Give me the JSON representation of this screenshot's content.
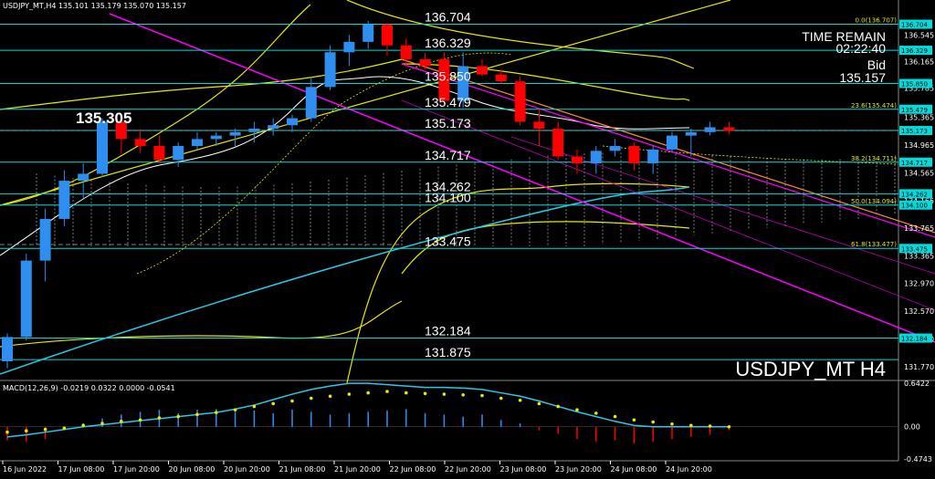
{
  "header": {
    "text": "USDJPY_MT,H4  135.101 135.179 135.070 135.157"
  },
  "symbol_label": "USDJPY_MT H4",
  "time_remain": {
    "label": "TIME REMAIN",
    "value": "02:22:40"
  },
  "bid": {
    "label": "Bid",
    "value": "135.157"
  },
  "macd_label": "MACD(12,26,9) -0.0219 0.0322 0.0000 -0.0541",
  "colors": {
    "bull": "#2f8ff0",
    "bear": "#ff0000",
    "level": "#00dcdc",
    "channel": "#ff00ff",
    "envelope": "#e8e800",
    "ma_fast": "#ffffff",
    "ma_slow": "#28c8e8",
    "cloud": "#808080",
    "fib": "#e8e800"
  },
  "chart_data": [
    {
      "type": "candlestick",
      "title": "USDJPY_MT H4",
      "ylim": [
        131.6,
        137.0
      ],
      "x": [
        "16 Jun 2022",
        "17 Jun 08:00",
        "17 Jun 20:00",
        "20 Jun 08:00",
        "20 Jun 20:00",
        "21 Jun 08:00",
        "21 Jun 20:00",
        "22 Jun 08:00",
        "22 Jun 20:00",
        "23 Jun 08:00",
        "23 Jun 20:00",
        "24 Jun 08:00",
        "24 Jun 20:00"
      ],
      "candles": [
        {
          "o": 131.85,
          "h": 132.25,
          "l": 131.75,
          "c": 132.2
        },
        {
          "o": 132.2,
          "h": 133.4,
          "l": 132.15,
          "c": 133.3
        },
        {
          "o": 133.3,
          "h": 134.05,
          "l": 133.0,
          "c": 133.9
        },
        {
          "o": 133.9,
          "h": 134.6,
          "l": 133.8,
          "c": 134.45
        },
        {
          "o": 134.45,
          "h": 134.7,
          "l": 134.2,
          "c": 134.55
        },
        {
          "o": 134.55,
          "h": 135.35,
          "l": 134.5,
          "c": 135.3
        },
        {
          "o": 135.3,
          "h": 135.35,
          "l": 134.85,
          "c": 135.05
        },
        {
          "o": 135.05,
          "h": 135.2,
          "l": 134.85,
          "c": 134.95
        },
        {
          "o": 134.95,
          "h": 135.1,
          "l": 134.7,
          "c": 134.75
        },
        {
          "o": 134.75,
          "h": 135.0,
          "l": 134.65,
          "c": 134.95
        },
        {
          "o": 134.95,
          "h": 135.15,
          "l": 134.9,
          "c": 135.05
        },
        {
          "o": 135.05,
          "h": 135.15,
          "l": 134.95,
          "c": 135.1
        },
        {
          "o": 135.1,
          "h": 135.2,
          "l": 134.95,
          "c": 135.15
        },
        {
          "o": 135.15,
          "h": 135.3,
          "l": 135.0,
          "c": 135.2
        },
        {
          "o": 135.2,
          "h": 135.35,
          "l": 135.1,
          "c": 135.25
        },
        {
          "o": 135.25,
          "h": 135.4,
          "l": 135.15,
          "c": 135.35
        },
        {
          "o": 135.35,
          "h": 135.95,
          "l": 135.3,
          "c": 135.8
        },
        {
          "o": 135.8,
          "h": 136.4,
          "l": 135.75,
          "c": 136.3
        },
        {
          "o": 136.3,
          "h": 136.55,
          "l": 136.1,
          "c": 136.45
        },
        {
          "o": 136.45,
          "h": 136.75,
          "l": 136.35,
          "c": 136.7
        },
        {
          "o": 136.7,
          "h": 136.72,
          "l": 136.25,
          "c": 136.4
        },
        {
          "o": 136.4,
          "h": 136.5,
          "l": 136.1,
          "c": 136.2
        },
        {
          "o": 136.2,
          "h": 136.3,
          "l": 136.05,
          "c": 136.1
        },
        {
          "o": 136.2,
          "h": 136.3,
          "l": 135.55,
          "c": 135.6
        },
        {
          "o": 135.6,
          "h": 136.3,
          "l": 135.5,
          "c": 136.1
        },
        {
          "o": 136.1,
          "h": 136.2,
          "l": 135.95,
          "c": 135.98
        },
        {
          "o": 135.98,
          "h": 136.05,
          "l": 135.85,
          "c": 135.88
        },
        {
          "o": 135.88,
          "h": 135.95,
          "l": 135.25,
          "c": 135.3
        },
        {
          "o": 135.3,
          "h": 135.5,
          "l": 134.95,
          "c": 135.2
        },
        {
          "o": 135.2,
          "h": 135.3,
          "l": 134.75,
          "c": 134.8
        },
        {
          "o": 134.8,
          "h": 134.9,
          "l": 134.55,
          "c": 134.7
        },
        {
          "o": 134.7,
          "h": 134.95,
          "l": 134.55,
          "c": 134.88
        },
        {
          "o": 134.88,
          "h": 135.05,
          "l": 134.8,
          "c": 134.95
        },
        {
          "o": 134.95,
          "h": 135.0,
          "l": 134.6,
          "c": 134.7
        },
        {
          "o": 134.7,
          "h": 134.95,
          "l": 134.55,
          "c": 134.9
        },
        {
          "o": 134.9,
          "h": 135.15,
          "l": 134.85,
          "c": 135.1
        },
        {
          "o": 135.1,
          "h": 135.2,
          "l": 134.8,
          "c": 135.15
        },
        {
          "o": 135.15,
          "h": 135.3,
          "l": 135.1,
          "c": 135.22
        },
        {
          "o": 135.22,
          "h": 135.3,
          "l": 135.12,
          "c": 135.17
        }
      ],
      "levels": [
        {
          "value": 136.704,
          "label": "136.704"
        },
        {
          "value": 136.329,
          "label": "136.329"
        },
        {
          "value": 135.85,
          "label": "135.850"
        },
        {
          "value": 135.479,
          "label": "135.479"
        },
        {
          "value": 135.173,
          "label": "135.173"
        },
        {
          "value": 134.717,
          "label": "134.717"
        },
        {
          "value": 134.262,
          "label": "134.262"
        },
        {
          "value": 134.1,
          "label": "134.100"
        },
        {
          "value": 133.475,
          "label": "133.475"
        },
        {
          "value": 132.184,
          "label": "132.184"
        },
        {
          "value": 131.875,
          "label": "131.875"
        }
      ],
      "fib": [
        {
          "value": 136.704,
          "label": "0.0(136.707)"
        },
        {
          "value": 135.474,
          "label": "23.6(135.474)"
        },
        {
          "value": 134.711,
          "label": "38.2(134.711)"
        },
        {
          "value": 134.094,
          "label": "50.0(134.094)"
        },
        {
          "value": 133.477,
          "label": "61.8(133.477)"
        }
      ],
      "highlight": {
        "value": 135.305,
        "label": "135.305"
      },
      "price_axis": [
        "136.545",
        "136.165",
        "135.785",
        "135.365",
        "134.965",
        "134.565",
        "134.165",
        "133.765",
        "133.365",
        "132.970",
        "132.570",
        "132.170",
        "131.770"
      ],
      "price_tags": [
        "136.704",
        "136.329",
        "135.850",
        "135.479",
        "135.173",
        "134.717",
        "134.262",
        "134.100",
        "133.475",
        "132.184"
      ]
    },
    {
      "type": "bar",
      "title": "MACD(12,26,9)",
      "ylim": [
        -0.4743,
        0.6422
      ],
      "price_axis": [
        "0.6422",
        "0.00",
        "-0.4743"
      ],
      "histogram": [
        -0.2,
        -0.22,
        -0.18,
        -0.05,
        0.05,
        0.12,
        0.18,
        0.22,
        0.25,
        0.2,
        0.25,
        0.26,
        0.22,
        0.24,
        0.2,
        0.25,
        0.22,
        0.18,
        0.2,
        0.22,
        0.24,
        0.26,
        0.2,
        0.18,
        0.15,
        0.18,
        0.1,
        0.05,
        -0.05,
        -0.1,
        -0.18,
        -0.22,
        -0.2,
        -0.25,
        -0.22,
        -0.18,
        -0.15,
        -0.12,
        -0.05
      ],
      "signal": [
        -0.08,
        -0.06,
        -0.04,
        -0.02,
        0.02,
        0.05,
        0.08,
        0.1,
        0.13,
        0.15,
        0.18,
        0.21,
        0.25,
        0.3,
        0.34,
        0.38,
        0.42,
        0.45,
        0.48,
        0.5,
        0.52,
        0.5,
        0.49,
        0.48,
        0.47,
        0.46,
        0.42,
        0.39,
        0.34,
        0.3,
        0.25,
        0.2,
        0.15,
        0.1,
        0.07,
        0.04,
        0.02,
        0.01,
        0.0
      ],
      "macd": [
        -0.15,
        -0.12,
        -0.08,
        -0.04,
        0.0,
        0.03,
        0.06,
        0.09,
        0.12,
        0.15,
        0.18,
        0.21,
        0.26,
        0.32,
        0.4,
        0.48,
        0.55,
        0.6,
        0.64,
        0.64,
        0.62,
        0.6,
        0.58,
        0.58,
        0.57,
        0.55,
        0.5,
        0.45,
        0.38,
        0.3,
        0.22,
        0.15,
        0.08,
        0.02,
        0.0,
        0.0,
        0.0,
        0.0,
        0.0
      ]
    }
  ]
}
